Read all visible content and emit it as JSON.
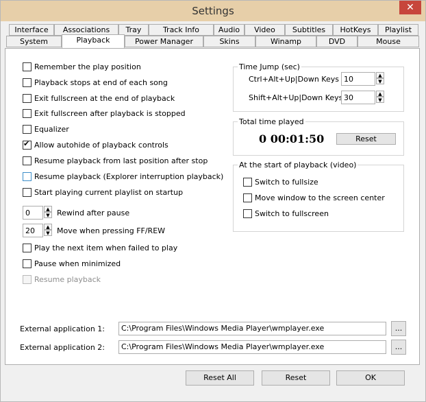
{
  "window": {
    "title": "Settings",
    "close_glyph": "✕"
  },
  "tabs_row1": [
    "Interface",
    "Associations",
    "Tray",
    "Track Info",
    "Audio",
    "Video",
    "Subtitles",
    "HotKeys",
    "Playlist"
  ],
  "tabs_row2": [
    "System",
    "Playback",
    "Power Manager",
    "Skins",
    "Winamp",
    "DVD",
    "Mouse"
  ],
  "active_tab": "Playback",
  "checkboxes": [
    {
      "label": "Remember the play position",
      "checked": false
    },
    {
      "label": "Playback stops at end of each song",
      "checked": false
    },
    {
      "label": "Exit fullscreen at the end of playback",
      "checked": false
    },
    {
      "label": "Exit fullscreen after playback is stopped",
      "checked": false
    },
    {
      "label": "Equalizer",
      "checked": false
    },
    {
      "label": "Allow autohide of playback controls",
      "checked": true
    },
    {
      "label": "Resume playback from last position after stop",
      "checked": false
    },
    {
      "label": "Resume playback  (Explorer interruption playback)",
      "checked": false
    },
    {
      "label": "Start playing current playlist on startup",
      "checked": false
    }
  ],
  "rewind": {
    "value": "0",
    "label": "Rewind after pause"
  },
  "ff": {
    "value": "20",
    "label": "Move when pressing FF/REW"
  },
  "checkboxes2": [
    {
      "label": "Play the next item when failed to play",
      "checked": false
    },
    {
      "label": "Pause when minimized",
      "checked": false
    },
    {
      "label": "Resume playback",
      "checked": false
    }
  ],
  "time_jump": {
    "title": "Time Jump (sec)",
    "ctrl_label": "Ctrl+Alt+Up|Down Keys",
    "ctrl_value": "10",
    "shift_label": "Shift+Alt+Up|Down Keys",
    "shift_value": "30"
  },
  "total_time": {
    "title": "Total time played",
    "value": "0 00:01:50",
    "reset_label": "Reset"
  },
  "start_playback": {
    "title": "At the start of playback (video)",
    "options": [
      "Switch to fullsize",
      "Move window to the screen center",
      "Switch to fullscreen"
    ]
  },
  "external": [
    {
      "label": "External application 1:",
      "value": "C:\\Program Files\\Windows Media Player\\wmplayer.exe",
      "browse": "..."
    },
    {
      "label": "External application 2:",
      "value": "C:\\Program Files\\Windows Media Player\\wmplayer.exe",
      "browse": "..."
    }
  ],
  "buttons": {
    "reset_all": "Reset All",
    "reset": "Reset",
    "ok": "OK"
  },
  "arrows": {
    "up": "▲",
    "down": "▼"
  }
}
